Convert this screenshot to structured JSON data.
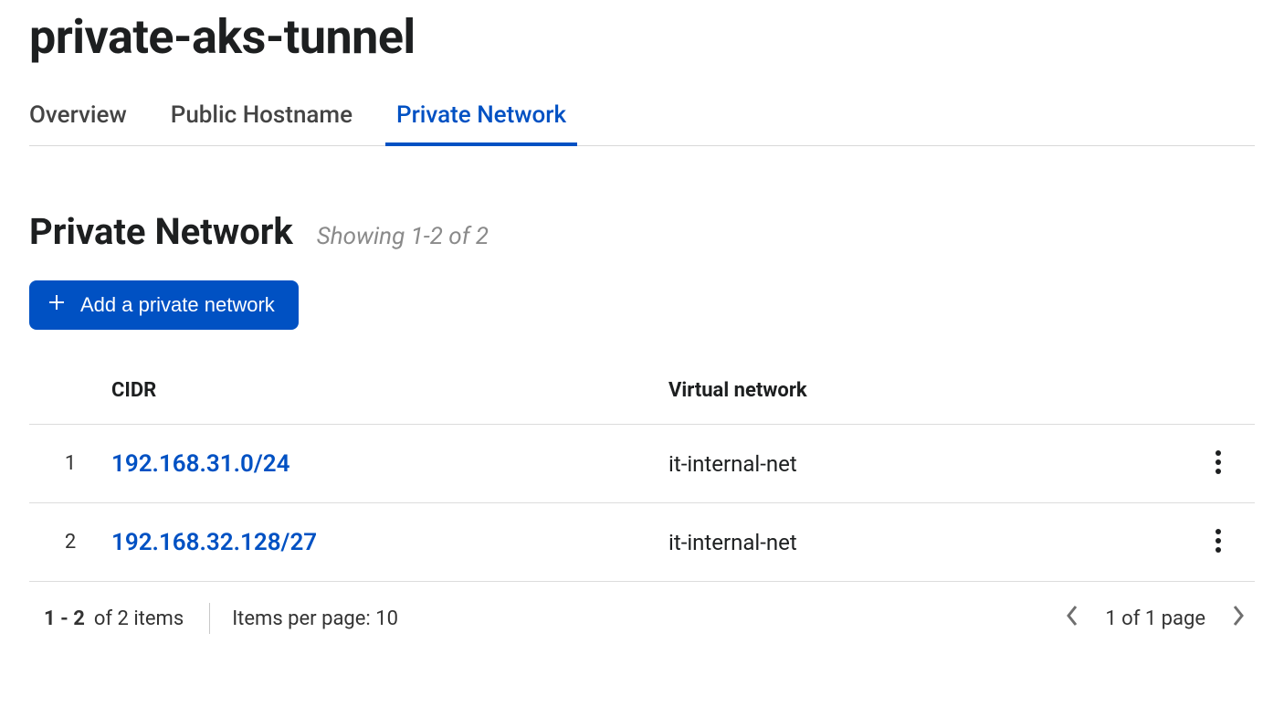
{
  "header": {
    "title": "private-aks-tunnel"
  },
  "tabs": [
    {
      "label": "Overview",
      "active": false
    },
    {
      "label": "Public Hostname",
      "active": false
    },
    {
      "label": "Private Network",
      "active": true
    }
  ],
  "section": {
    "title": "Private Network",
    "showing": "Showing 1-2 of 2"
  },
  "actions": {
    "add_label": "Add a private network"
  },
  "table": {
    "columns": {
      "cidr": "CIDR",
      "vnet": "Virtual network"
    },
    "rows": [
      {
        "idx": "1",
        "cidr": "192.168.31.0/24",
        "vnet": "it-internal-net"
      },
      {
        "idx": "2",
        "cidr": "192.168.32.128/27",
        "vnet": "it-internal-net"
      }
    ]
  },
  "pagination": {
    "range": "1 - 2",
    "of_items": "of 2 items",
    "per_page": "Items per page: 10",
    "page_of": "1 of 1 page"
  }
}
